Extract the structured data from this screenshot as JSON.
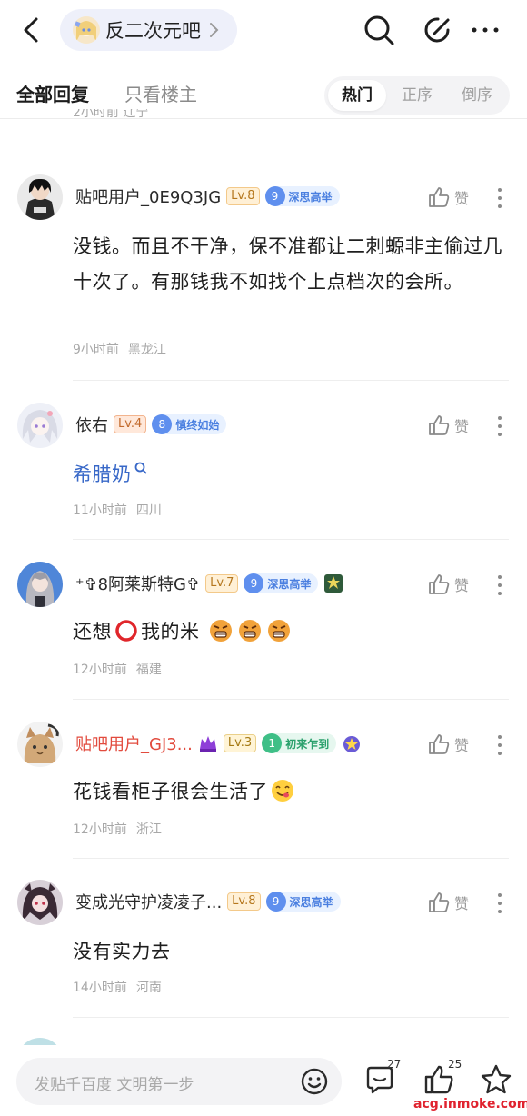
{
  "nav": {
    "forum_name": "反二次元吧"
  },
  "tabs": {
    "all": "全部回复",
    "owner_only": "只看楼主",
    "sort": [
      "热门",
      "正序",
      "倒序"
    ],
    "sort_active": "热门"
  },
  "cut_meta": "2小时前  辽宁",
  "posts": [
    {
      "username": "贴吧用户_0E9Q3JG",
      "level": "Lv.8",
      "badge_num": "9",
      "badge_text": "深思高举",
      "like_label": "赞",
      "content": "没钱。而且不干净，保不准都让二刺螈非主偷过几十次了。有那钱我不如找个上点档次的会所。",
      "time": "9小时前",
      "location": "黑龙江"
    },
    {
      "username": "依右",
      "level": "Lv.4",
      "badge_num": "8",
      "badge_text": "慎终如始",
      "like_label": "赞",
      "content": "希腊奶",
      "time": "11小时前",
      "location": "四川"
    },
    {
      "username": "⁺✞8阿莱斯特G✞",
      "level": "Lv.7",
      "badge_num": "9",
      "badge_text": "深思高举",
      "like_label": "赞",
      "content_a": "还想",
      "content_b": "我的米",
      "time": "12小时前",
      "location": "福建"
    },
    {
      "username": "贴吧用户_GJ3...",
      "level": "Lv.3",
      "badge_num": "1",
      "badge_text": "初来乍到",
      "like_label": "赞",
      "content": "花钱看柜子很会生活了",
      "time": "12小时前",
      "location": "浙江"
    },
    {
      "username": "变成光守护凌凌子...",
      "level": "Lv.8",
      "badge_num": "9",
      "badge_text": "深思高举",
      "like_label": "赞",
      "content": "没有实力去",
      "time": "14小时前",
      "location": "河南"
    }
  ],
  "bottom": {
    "input_placeholder": "发贴千百度 文明第一步",
    "comment_count": "27",
    "like_count": "25"
  },
  "watermark": "acg.inmoke.com",
  "colors": {
    "accent_blue": "#3868c8",
    "vip_red": "#e24b3e",
    "watermark_red": "#e0232f"
  },
  "icons": [
    "back-arrow-icon",
    "search-icon",
    "edit-icon",
    "more-icon",
    "thumbs-up-icon",
    "magnifier-link-icon",
    "smile-icon",
    "comment-icon",
    "star-icon"
  ]
}
